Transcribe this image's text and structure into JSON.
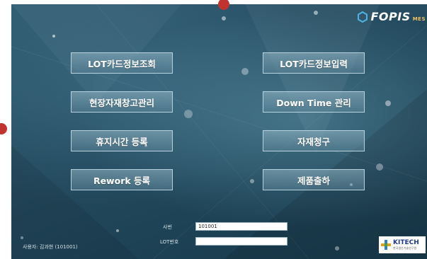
{
  "logo": {
    "text": "FOPIS",
    "mini": "MES"
  },
  "buttons": {
    "lot_card_inquiry": "LOT카드정보조회",
    "lot_card_input": "LOT카드정보입력",
    "site_material_warehouse": "현장자재창고관리",
    "downtime_management": "Down Time 관리",
    "rest_time_register": "휴지시간 등록",
    "material_request": "자재청구",
    "rework_register": "Rework 등록",
    "product_shipment": "제품출하"
  },
  "form": {
    "employee_id_label": "사번",
    "employee_id_value": "101001",
    "lot_no_label": "LOT번호",
    "lot_no_value": ""
  },
  "footer": {
    "user_label": "사용자: 김과현 (101001)"
  },
  "kitech": {
    "name": "KITECH",
    "sub": "한국생산기술연구원"
  },
  "colors": {
    "marker": "#c0332e",
    "background": "#23495d"
  }
}
